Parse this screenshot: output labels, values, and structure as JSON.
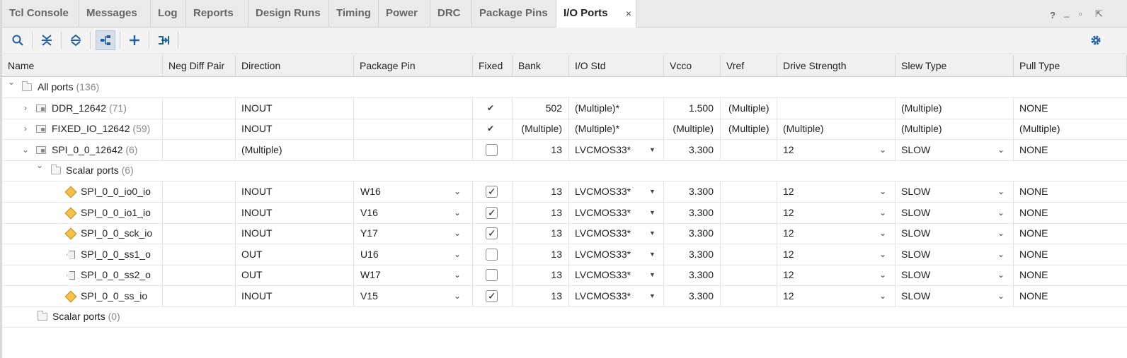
{
  "tabs": [
    {
      "label": "Tcl Console"
    },
    {
      "label": "Messages"
    },
    {
      "label": "Log"
    },
    {
      "label": "Reports"
    },
    {
      "label": "Design Runs"
    },
    {
      "label": "Timing"
    },
    {
      "label": "Power"
    },
    {
      "label": "DRC"
    },
    {
      "label": "Package Pins"
    },
    {
      "label": "I/O Ports",
      "active": true
    }
  ],
  "tab_close": "×",
  "window_controls": {
    "help": "?",
    "minimize": "_",
    "restore": "▫",
    "float": "⇱"
  },
  "toolbar": {
    "icons": [
      "search-icon",
      "collapse-all-icon",
      "expand-all-icon",
      "group-by-interface-icon",
      "add-icon",
      "auto-place-icon"
    ],
    "settings_icon": "gear-icon",
    "accent": "#1d5fa3"
  },
  "columns": [
    "Name",
    "Neg Diff Pair",
    "Direction",
    "Package Pin",
    "Fixed",
    "Bank",
    "I/O Std",
    "Vcco",
    "Vref",
    "Drive Strength",
    "Slew Type",
    "Pull Type"
  ],
  "tree": {
    "root": {
      "name": "All ports",
      "count": "(136)"
    },
    "ddr": {
      "name": "DDR_12642",
      "count": "(71)",
      "direction": "INOUT",
      "fixed": "✔",
      "bank": "502",
      "iostd": "(Multiple)*",
      "vcco": "1.500",
      "vref": "(Multiple)",
      "slew": "(Multiple)",
      "pull": "NONE"
    },
    "fixed_io": {
      "name": "FIXED_IO_12642",
      "count": "(59)",
      "direction": "INOUT",
      "fixed": "✔",
      "bank": "(Multiple)",
      "iostd": "(Multiple)*",
      "vcco": "(Multiple)",
      "vref": "(Multiple)",
      "drive": "(Multiple)",
      "slew": "(Multiple)",
      "pull": "(Multiple)"
    },
    "spi": {
      "name": "SPI_0_0_12642",
      "count": "(6)",
      "direction": "(Multiple)",
      "bank": "13",
      "iostd": "LVCMOS33*",
      "vcco": "3.300",
      "drive": "12",
      "slew": "SLOW",
      "pull": "NONE"
    },
    "spi_scalar": {
      "name": "Scalar ports",
      "count": "(6)"
    },
    "ports": [
      {
        "name": "SPI_0_0_io0_io",
        "kind": "inout",
        "direction": "INOUT",
        "pin": "W16",
        "fixed": true,
        "bank": "13",
        "iostd": "LVCMOS33*",
        "vcco": "3.300",
        "drive": "12",
        "slew": "SLOW",
        "pull": "NONE"
      },
      {
        "name": "SPI_0_0_io1_io",
        "kind": "inout",
        "direction": "INOUT",
        "pin": "V16",
        "fixed": true,
        "bank": "13",
        "iostd": "LVCMOS33*",
        "vcco": "3.300",
        "drive": "12",
        "slew": "SLOW",
        "pull": "NONE"
      },
      {
        "name": "SPI_0_0_sck_io",
        "kind": "inout",
        "direction": "INOUT",
        "pin": "Y17",
        "fixed": true,
        "bank": "13",
        "iostd": "LVCMOS33*",
        "vcco": "3.300",
        "drive": "12",
        "slew": "SLOW",
        "pull": "NONE"
      },
      {
        "name": "SPI_0_0_ss1_o",
        "kind": "out",
        "direction": "OUT",
        "pin": "U16",
        "fixed": false,
        "bank": "13",
        "iostd": "LVCMOS33*",
        "vcco": "3.300",
        "drive": "12",
        "slew": "SLOW",
        "pull": "NONE"
      },
      {
        "name": "SPI_0_0_ss2_o",
        "kind": "out",
        "direction": "OUT",
        "pin": "W17",
        "fixed": false,
        "bank": "13",
        "iostd": "LVCMOS33*",
        "vcco": "3.300",
        "drive": "12",
        "slew": "SLOW",
        "pull": "NONE"
      },
      {
        "name": "SPI_0_0_ss_io",
        "kind": "inout",
        "direction": "INOUT",
        "pin": "V15",
        "fixed": true,
        "bank": "13",
        "iostd": "LVCMOS33*",
        "vcco": "3.300",
        "drive": "12",
        "slew": "SLOW",
        "pull": "NONE"
      }
    ],
    "root_scalar": {
      "name": "Scalar ports",
      "count": "(0)"
    }
  }
}
